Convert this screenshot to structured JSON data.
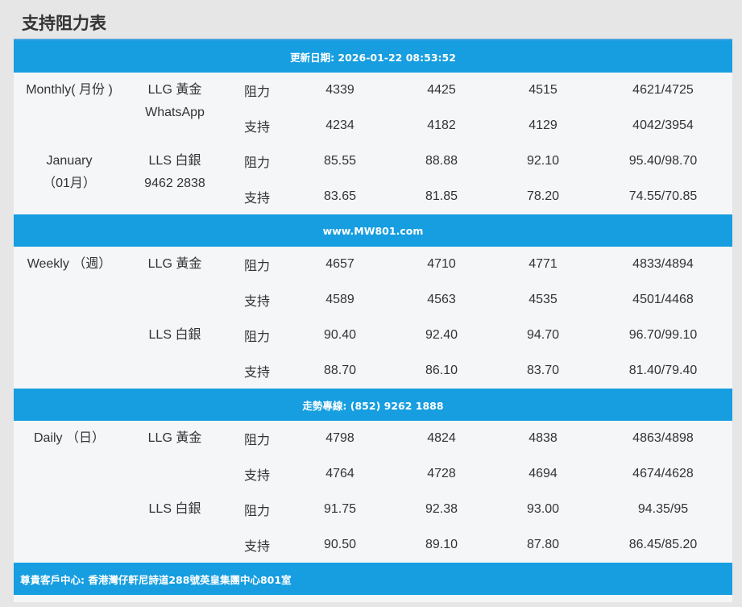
{
  "title": "支持阻力表",
  "banner_top": "更新日期: 2026-01-22 08:53:52",
  "monthly": {
    "period_line1": "Monthly( 月份 )",
    "period_line2": "January",
    "period_line3": "（01月）",
    "gold_name": "LLG 黃金",
    "gold_extra": "WhatsApp",
    "silver_name": "LLS 白銀",
    "silver_extra": "9462 2838",
    "rows": [
      {
        "type": "阻力",
        "v1": "4339",
        "v2": "4425",
        "v3": "4515",
        "v4": "4621/4725"
      },
      {
        "type": "支持",
        "v1": "4234",
        "v2": "4182",
        "v3": "4129",
        "v4": "4042/3954"
      },
      {
        "type": "阻力",
        "v1": "85.55",
        "v2": "88.88",
        "v3": "92.10",
        "v4": "95.40/98.70"
      },
      {
        "type": "支持",
        "v1": "83.65",
        "v2": "81.85",
        "v3": "78.20",
        "v4": "74.55/70.85"
      }
    ]
  },
  "banner_mid1": "www.MW801.com",
  "weekly": {
    "period": "Weekly （週）",
    "gold_name": "LLG 黃金",
    "silver_name": "LLS 白銀",
    "rows": [
      {
        "type": "阻力",
        "v1": "4657",
        "v2": "4710",
        "v3": "4771",
        "v4": "4833/4894"
      },
      {
        "type": "支持",
        "v1": "4589",
        "v2": "4563",
        "v3": "4535",
        "v4": "4501/4468"
      },
      {
        "type": "阻力",
        "v1": "90.40",
        "v2": "92.40",
        "v3": "94.70",
        "v4": "96.70/99.10"
      },
      {
        "type": "支持",
        "v1": "88.70",
        "v2": "86.10",
        "v3": "83.70",
        "v4": "81.40/79.40"
      }
    ]
  },
  "banner_mid2": "走勢專線: (852) 9262 1888",
  "daily": {
    "period": "Daily （日）",
    "gold_name": "LLG 黃金",
    "silver_name": "LLS 白銀",
    "rows": [
      {
        "type": "阻力",
        "v1": "4798",
        "v2": "4824",
        "v3": "4838",
        "v4": "4863/4898"
      },
      {
        "type": "支持",
        "v1": "4764",
        "v2": "4728",
        "v3": "4694",
        "v4": "4674/4628"
      },
      {
        "type": "阻力",
        "v1": "91.75",
        "v2": "92.38",
        "v3": "93.00",
        "v4": "94.35/95"
      },
      {
        "type": "支持",
        "v1": "90.50",
        "v2": "89.10",
        "v3": "87.80",
        "v4": "86.45/85.20"
      }
    ]
  },
  "footer": "尊貴客戶中心: 香港灣仔軒尼詩道288號英皇集團中心801室"
}
